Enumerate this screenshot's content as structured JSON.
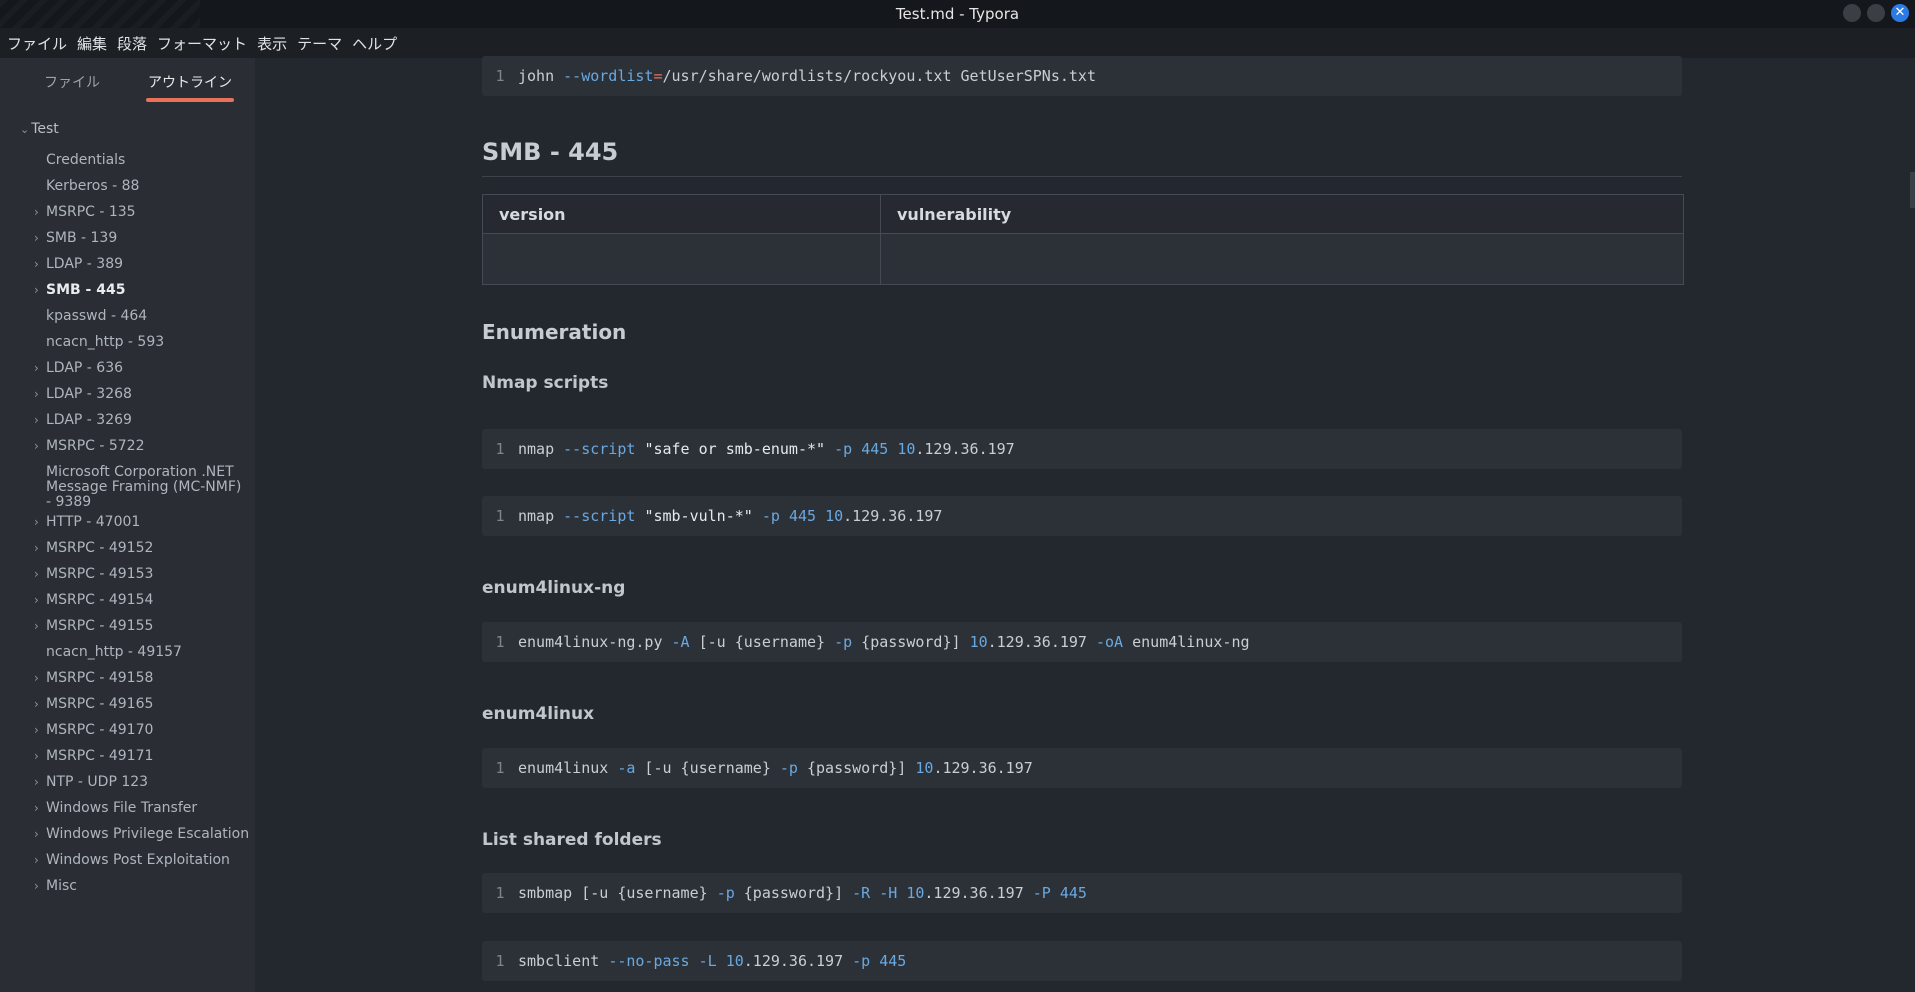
{
  "window": {
    "title": "Test.md - Typora",
    "close_glyph": "✕"
  },
  "menu": [
    "ファイル",
    "編集",
    "段落",
    "フォーマット",
    "表示",
    "テーマ",
    "ヘルプ"
  ],
  "sidebar": {
    "tabs": [
      {
        "label": "ファイル",
        "active": false
      },
      {
        "label": "アウトライン",
        "active": true
      }
    ],
    "root": {
      "label": "Test",
      "expanded": true
    },
    "items": [
      {
        "label": "Credentials",
        "has_children": false
      },
      {
        "label": "Kerberos - 88",
        "has_children": false
      },
      {
        "label": "MSRPC - 135",
        "has_children": true
      },
      {
        "label": "SMB - 139",
        "has_children": true
      },
      {
        "label": "LDAP - 389",
        "has_children": true
      },
      {
        "label": "SMB - 445",
        "has_children": true,
        "active": true
      },
      {
        "label": "kpasswd - 464",
        "has_children": false
      },
      {
        "label": "ncacn_http - 593",
        "has_children": false
      },
      {
        "label": "LDAP - 636",
        "has_children": true
      },
      {
        "label": "LDAP - 3268",
        "has_children": true
      },
      {
        "label": "LDAP - 3269",
        "has_children": true
      },
      {
        "label": "MSRPC - 5722",
        "has_children": true
      },
      {
        "label": "Microsoft Corporation .NET Message Framing (MC-NMF) - 9389",
        "has_children": false
      },
      {
        "label": "HTTP - 47001",
        "has_children": true
      },
      {
        "label": "MSRPC - 49152",
        "has_children": true
      },
      {
        "label": "MSRPC - 49153",
        "has_children": true
      },
      {
        "label": "MSRPC - 49154",
        "has_children": true
      },
      {
        "label": "MSRPC - 49155",
        "has_children": true
      },
      {
        "label": "ncacn_http - 49157",
        "has_children": false
      },
      {
        "label": "MSRPC - 49158",
        "has_children": true
      },
      {
        "label": "MSRPC - 49165",
        "has_children": true
      },
      {
        "label": "MSRPC - 49170",
        "has_children": true
      },
      {
        "label": "MSRPC - 49171",
        "has_children": true
      },
      {
        "label": "NTP - UDP 123",
        "has_children": true
      },
      {
        "label": "Windows File Transfer",
        "has_children": true
      },
      {
        "label": "Windows Privilege Escalation",
        "has_children": true
      },
      {
        "label": "Windows Post Exploitation",
        "has_children": true
      },
      {
        "label": "Misc",
        "has_children": true
      }
    ]
  },
  "editor": {
    "code_top": {
      "line": "1",
      "parts": [
        [
          "t",
          "john "
        ],
        [
          "k",
          "--wordlist"
        ],
        [
          "op",
          "="
        ],
        [
          "t",
          "/usr/share/wordlists/rockyou.txt GetUserSPNs.txt"
        ]
      ]
    },
    "heading_smb": "SMB - 445",
    "table": {
      "headers": [
        "version",
        "vulnerability"
      ],
      "rows": [
        [
          "",
          ""
        ]
      ]
    },
    "heading_enum": "Enumeration",
    "heading_nmap": "Nmap scripts",
    "code_nmap1": {
      "line": "1",
      "parts": [
        [
          "t",
          "nmap "
        ],
        [
          "k",
          "--script "
        ],
        [
          "s",
          "\"safe or smb-enum-*\""
        ],
        [
          "t",
          " "
        ],
        [
          "k",
          "-p"
        ],
        [
          "t",
          " "
        ],
        [
          "n",
          "445"
        ],
        [
          "t",
          " "
        ],
        [
          "n",
          "10"
        ],
        [
          "t",
          ".129.36.197"
        ]
      ]
    },
    "code_nmap2": {
      "line": "1",
      "parts": [
        [
          "t",
          "nmap "
        ],
        [
          "k",
          "--script "
        ],
        [
          "s",
          "\"smb-vuln-*\""
        ],
        [
          "t",
          " "
        ],
        [
          "k",
          "-p"
        ],
        [
          "t",
          " "
        ],
        [
          "n",
          "445"
        ],
        [
          "t",
          " "
        ],
        [
          "n",
          "10"
        ],
        [
          "t",
          ".129.36.197"
        ]
      ]
    },
    "heading_e4lng": "enum4linux-ng",
    "code_e4lng": {
      "line": "1",
      "parts": [
        [
          "t",
          "enum4linux-ng.py "
        ],
        [
          "k",
          "-A"
        ],
        [
          "t",
          " [-u {username} "
        ],
        [
          "k",
          "-p"
        ],
        [
          "t",
          " {password}] "
        ],
        [
          "n",
          "10"
        ],
        [
          "t",
          ".129.36.197 "
        ],
        [
          "k",
          "-oA"
        ],
        [
          "t",
          " enum4linux-ng"
        ]
      ]
    },
    "heading_e4l": "enum4linux",
    "code_e4l": {
      "line": "1",
      "parts": [
        [
          "t",
          "enum4linux "
        ],
        [
          "k",
          "-a"
        ],
        [
          "t",
          " [-u {username} "
        ],
        [
          "k",
          "-p"
        ],
        [
          "t",
          " {password}] "
        ],
        [
          "n",
          "10"
        ],
        [
          "t",
          ".129.36.197"
        ]
      ]
    },
    "heading_shares": "List shared folders",
    "code_smbmap": {
      "line": "1",
      "parts": [
        [
          "t",
          "smbmap [-u {username} "
        ],
        [
          "k",
          "-p"
        ],
        [
          "t",
          " {password}] "
        ],
        [
          "k",
          "-R -H"
        ],
        [
          "t",
          " "
        ],
        [
          "n",
          "10"
        ],
        [
          "t",
          ".129.36.197 "
        ],
        [
          "k",
          "-P"
        ],
        [
          "t",
          " "
        ],
        [
          "n",
          "445"
        ]
      ]
    },
    "code_smbclient": {
      "line": "1",
      "parts": [
        [
          "t",
          "smbclient "
        ],
        [
          "k",
          "--no-pass -L"
        ],
        [
          "t",
          " "
        ],
        [
          "n",
          "10"
        ],
        [
          "t",
          ".129.36.197 "
        ],
        [
          "k",
          "-p"
        ],
        [
          "t",
          " "
        ],
        [
          "n",
          "445"
        ]
      ]
    }
  }
}
